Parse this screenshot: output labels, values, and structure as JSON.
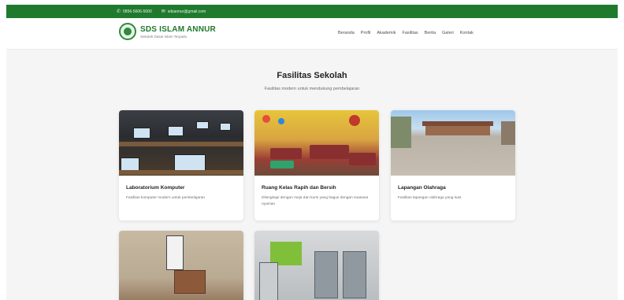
{
  "topbar": {
    "phone": "0856-5606-5000",
    "email": "sdsannur@gmail.com",
    "phone_icon": "phone-icon",
    "email_icon": "mail-icon"
  },
  "header": {
    "brand_name": "SDS ISLAM ANNUR",
    "brand_tagline": "Sekolah Dasar Islam Terpadu",
    "logo_icon": "school-logo-icon",
    "nav": [
      "Beranda",
      "Profil",
      "Akademik",
      "Fasilitas",
      "Berita",
      "Galeri",
      "Kontak"
    ]
  },
  "section": {
    "title": "Fasilitas Sekolah",
    "subtitle": "Fasilitas modern untuk mendukung pembelajaran"
  },
  "cards": [
    {
      "title": "Laboratorium Komputer",
      "desc": "Fasilitas komputer modern untuk pembelajaran"
    },
    {
      "title": "Ruang Kelas Rapih dan Bersih",
      "desc": "Dilengkapi dengan meja dan kursi yang bagus dengan suasana nyaman"
    },
    {
      "title": "Lapangan Olahraga",
      "desc": "Fasilitas lapangan olahraga yang luas"
    },
    {
      "title": "",
      "desc": ""
    },
    {
      "title": "",
      "desc": ""
    }
  ],
  "colors": {
    "brand_green": "#1f7a2e",
    "page_bg": "#f4f5f4"
  }
}
